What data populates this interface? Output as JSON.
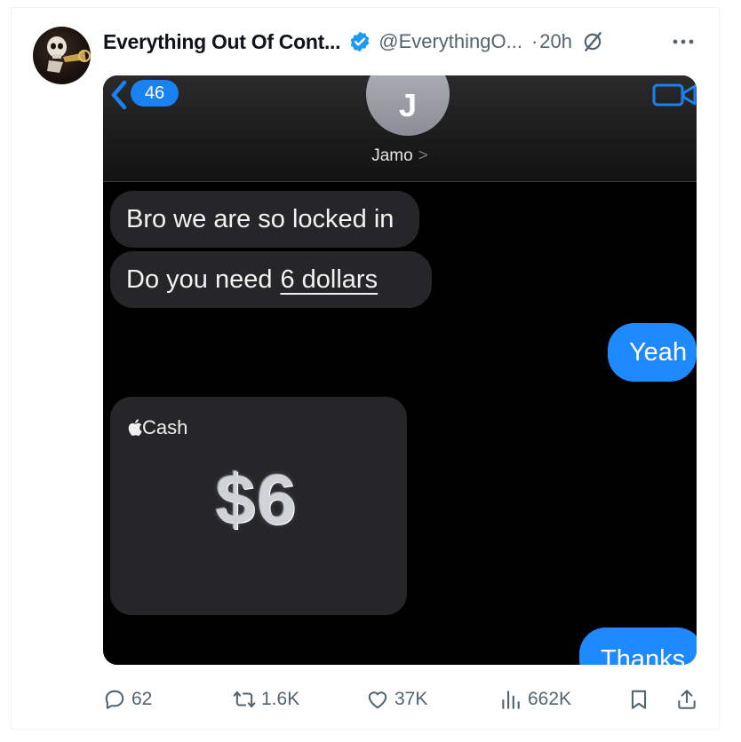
{
  "post": {
    "author_name": "Everything Out Of Cont...",
    "author_handle": "@EverythingO...",
    "separator": "·",
    "timestamp": "20h"
  },
  "media": {
    "back_count": "46",
    "contact_initial": "J",
    "contact_name": "Jamo",
    "contact_chevron": ">",
    "messages": {
      "incoming_1": "Bro we are so locked in",
      "incoming_2_prefix": "Do you need",
      "incoming_2_link": "6 dollars",
      "outgoing_1": "Yeah",
      "outgoing_2": "Thanks"
    },
    "cash_card": {
      "label": "Cash",
      "amount": "$6"
    }
  },
  "actions": {
    "replies": "62",
    "reposts": "1.6K",
    "likes": "37K",
    "views": "662K"
  },
  "colors": {
    "verified_blue": "#1d9bf0",
    "imessage_blue": "#1f8aff",
    "muted_text": "#536471"
  }
}
